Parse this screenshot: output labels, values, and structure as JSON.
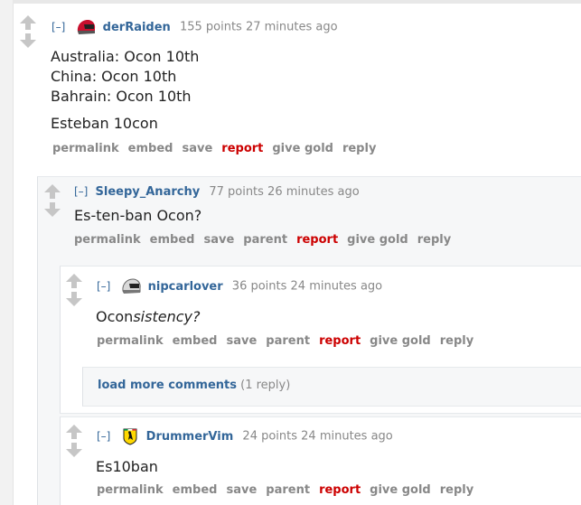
{
  "comments": [
    {
      "toggle": "[–]",
      "author": "derRaiden",
      "score_time": "155 points 27 minutes ago",
      "body_lines": [
        "Australia: Ocon 10th",
        "China: Ocon 10th",
        "Bahrain: Ocon 10th"
      ],
      "body_extra": "Esteban 10con",
      "buttons": [
        "permalink",
        "embed",
        "save",
        "report",
        "give gold",
        "reply"
      ]
    },
    {
      "toggle": "[–]",
      "author": "Sleepy_Anarchy",
      "score_time": "77 points 26 minutes ago",
      "body": "Es-ten-ban Ocon?",
      "buttons": [
        "permalink",
        "embed",
        "save",
        "parent",
        "report",
        "give gold",
        "reply"
      ]
    },
    {
      "toggle": "[–]",
      "author": "nipcarlover",
      "score_time": "36 points 24 minutes ago",
      "body_plain": "Ocon",
      "body_italic": "sistency?",
      "buttons": [
        "permalink",
        "embed",
        "save",
        "parent",
        "report",
        "give gold",
        "reply"
      ]
    },
    {
      "toggle": "[–]",
      "author": "DrummerVim",
      "score_time": "24 points 24 minutes ago",
      "body": "Es10ban",
      "buttons": [
        "permalink",
        "embed",
        "save",
        "parent",
        "report",
        "give gold",
        "reply"
      ]
    }
  ],
  "load_more": {
    "label": "load more comments",
    "count": "(1 reply)"
  },
  "colors": {
    "author": "#336699",
    "report": "#cc0000",
    "meta": "#888888",
    "nested_bg": "#f6f7f8"
  },
  "icons": [
    "upvote-arrow-icon",
    "downvote-arrow-icon",
    "helmet-flair-icon",
    "ferrari-flair-icon"
  ]
}
